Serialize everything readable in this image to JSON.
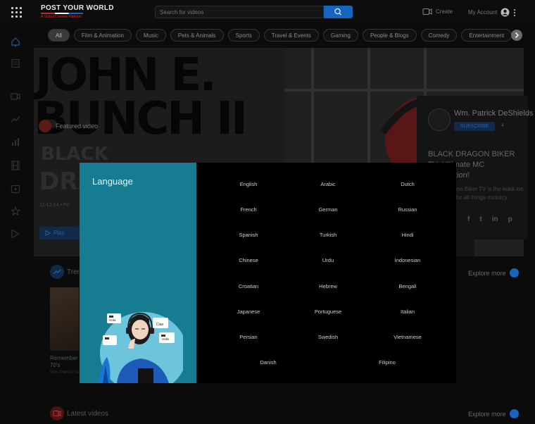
{
  "header": {
    "logo_title": "POST YOUR WORLD",
    "logo_tagline": "A Global Content Platform",
    "search_placeholder": "Search for videos",
    "create_label": "Create",
    "account_label": "My Account"
  },
  "categories": [
    "All",
    "Film & Animation",
    "Music",
    "Pets & Animals",
    "Sports",
    "Travel & Events",
    "Gaming",
    "People & Blogs",
    "Comedy",
    "Entertainment"
  ],
  "featured": {
    "badge_label": "Featured video",
    "poster_line1": "JOHN E.",
    "poster_line2": "BUNCH II",
    "poster_line3": "BLACK",
    "poster_line4": "DRA",
    "meta": "11-12-24 • Fe",
    "play_label": "Play"
  },
  "channel": {
    "name": "Wm. Patrick DeShields",
    "subscribe_label": "SUBSCRIBE",
    "subscriber_count": "4",
    "video_title": "BLACK DRAGON BIKER TV: Ultimate MC Connection!",
    "description": "ion Biker TV is the leadi ion for all things motorcy",
    "socials": [
      "f",
      "t",
      "in",
      "p"
    ]
  },
  "sections": {
    "trending_label": "Tren",
    "latest_label": "Latest videos",
    "explore_label": "Explore more"
  },
  "trending_card": {
    "title": "Remember 70's",
    "sub": "Wm. Patrick Cabana Film"
  },
  "language_modal": {
    "title": "Language",
    "languages": [
      "English",
      "Arabic",
      "Dutch",
      "French",
      "German",
      "Russian",
      "Spanish",
      "Turkish",
      "Hindi",
      "Chinese",
      "Urdu",
      "Indonesian",
      "Croatian",
      "Hebrew",
      "Bengali",
      "Japanese",
      "Portuguese",
      "Italian",
      "Persian",
      "Swedish",
      "Vietnamese",
      "Danish",
      "Filipino"
    ],
    "bubble_words": [
      "Hola",
      "Ciao",
      "Hello"
    ]
  },
  "colors": {
    "accent": "#1565c0",
    "modal_panel": "#167c91",
    "brand_red": "#c62828"
  }
}
